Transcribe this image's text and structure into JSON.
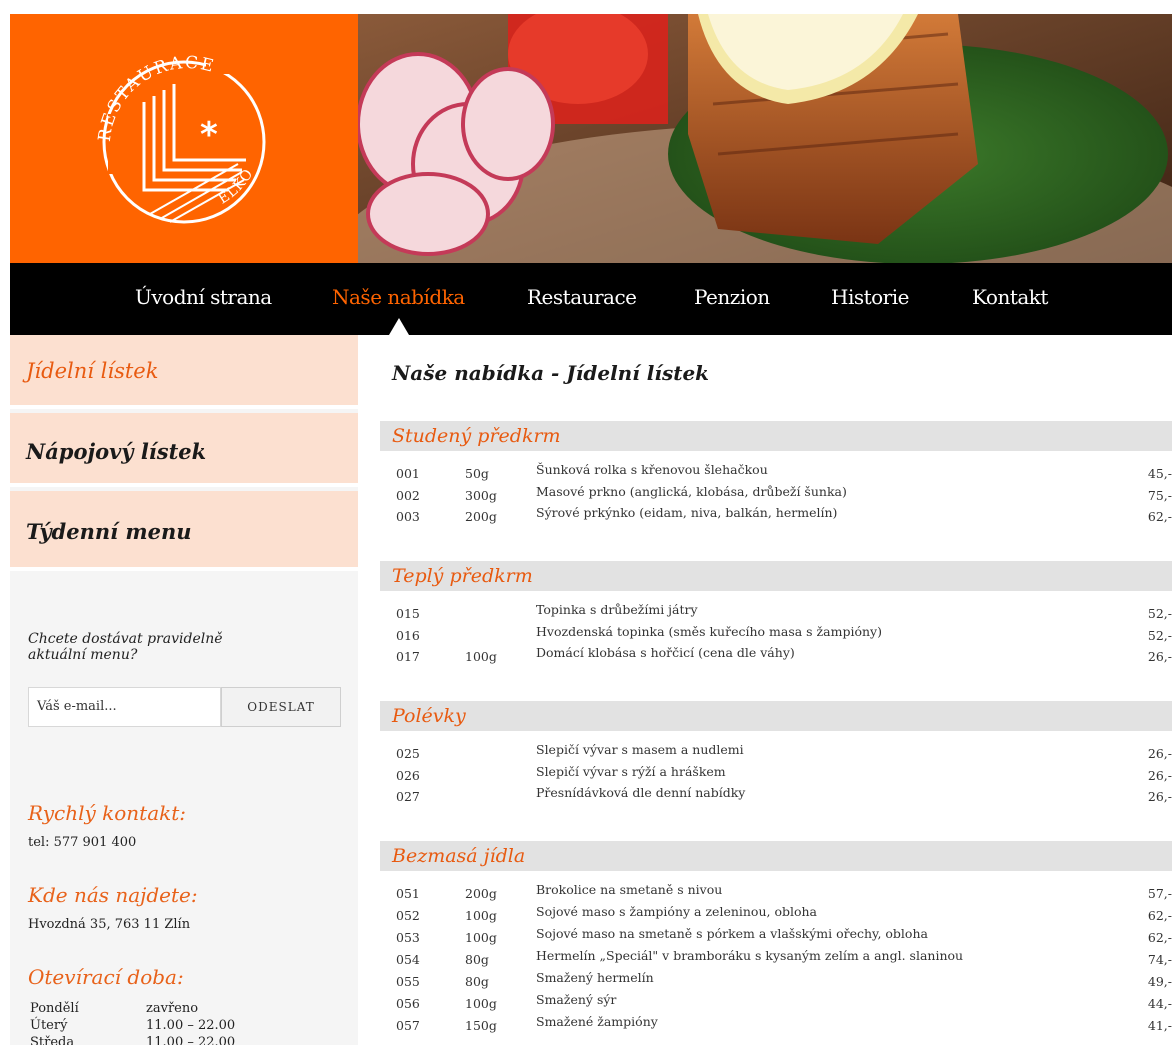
{
  "brand": {
    "logo_arc_text": "RESTAURACE",
    "logo_sub_text": "ELKO",
    "colors": {
      "accent": "#ff6400",
      "nav_bg": "#000000",
      "tab_bg": "#fce0d0",
      "section_bg": "#e2e2e2"
    }
  },
  "nav": {
    "items": [
      {
        "label": "Úvodní strana"
      },
      {
        "label": "Naše nabídka",
        "active": true
      },
      {
        "label": "Restaurace"
      },
      {
        "label": "Penzion"
      },
      {
        "label": "Historie"
      },
      {
        "label": "Kontakt"
      }
    ]
  },
  "sidebar": {
    "tabs": [
      {
        "label": "Jídelní lístek",
        "active": true
      },
      {
        "label": "Nápojový lístek"
      },
      {
        "label": "Týdenní menu"
      }
    ],
    "newsletter": {
      "question": "Chcete dostávat pravidelně aktuální menu?",
      "email_placeholder": "Váš e-mail...",
      "send_label": "ODESLAT"
    },
    "contact": {
      "quick_heading": "Rychlý kontakt:",
      "phone": "tel: 577 901 400",
      "address_heading": "Kde nás najdete:",
      "address": "Hvozdná 35, 763 11 Zlín",
      "hours_heading": "Otevírací doba:",
      "hours": [
        {
          "day": "Pondělí",
          "time": "zavřeno"
        },
        {
          "day": "Úterý",
          "time": "11.00 – 22.00"
        },
        {
          "day": "Středa",
          "time": "11.00 – 22.00"
        }
      ]
    }
  },
  "main": {
    "title": "Naše nabídka - Jídelní lístek",
    "sections": [
      {
        "heading": "Studený předkrm",
        "items": [
          {
            "code": "001",
            "weight": "50g",
            "name": "Šunková rolka s křenovou šlehačkou",
            "price": "45,-"
          },
          {
            "code": "002",
            "weight": "300g",
            "name": "Masové prkno (anglická, klobása, drůbeží šunka)",
            "price": "75,-"
          },
          {
            "code": "003",
            "weight": "200g",
            "name": "Sýrové prkýnko (eidam, niva, balkán, hermelín)",
            "price": "62,-"
          }
        ]
      },
      {
        "heading": "Teplý předkrm",
        "items": [
          {
            "code": "015",
            "weight": "",
            "name": "Topinka s drůbežími játry",
            "price": "52,-"
          },
          {
            "code": "016",
            "weight": "",
            "name": "Hvozdenská topinka (směs kuřecího masa s žampióny)",
            "price": "52,-"
          },
          {
            "code": "017",
            "weight": "100g",
            "name": "Domácí klobása s hořčicí (cena dle váhy)",
            "price": "26,-"
          }
        ]
      },
      {
        "heading": "Polévky",
        "items": [
          {
            "code": "025",
            "weight": "",
            "name": "Slepičí vývar s masem a nudlemi",
            "price": "26,-"
          },
          {
            "code": "026",
            "weight": "",
            "name": "Slepičí vývar s rýží a hráškem",
            "price": "26,-"
          },
          {
            "code": "027",
            "weight": "",
            "name": "Přesnídávková dle denní nabídky",
            "price": "26,-"
          }
        ]
      },
      {
        "heading": "Bezmasá jídla",
        "items": [
          {
            "code": "051",
            "weight": "200g",
            "name": "Brokolice na smetaně s nivou",
            "price": "57,-"
          },
          {
            "code": "052",
            "weight": "100g",
            "name": "Sojové maso s žampióny a zeleninou, obloha",
            "price": "62,-"
          },
          {
            "code": "053",
            "weight": "100g",
            "name": "Sojové maso na smetaně s pórkem a vlašskými ořechy, obloha",
            "price": "62,-"
          },
          {
            "code": "054",
            "weight": "80g",
            "name": "Hermelín „Speciál\" v bramboráku s kysaným zelím a angl. slaninou",
            "price": "74,-"
          },
          {
            "code": "055",
            "weight": "80g",
            "name": "Smažený hermelín",
            "price": "49,-"
          },
          {
            "code": "056",
            "weight": "100g",
            "name": "Smažený sýr",
            "price": "44,-"
          },
          {
            "code": "057",
            "weight": "150g",
            "name": "Smažené žampióny",
            "price": "41,-"
          }
        ]
      }
    ]
  }
}
